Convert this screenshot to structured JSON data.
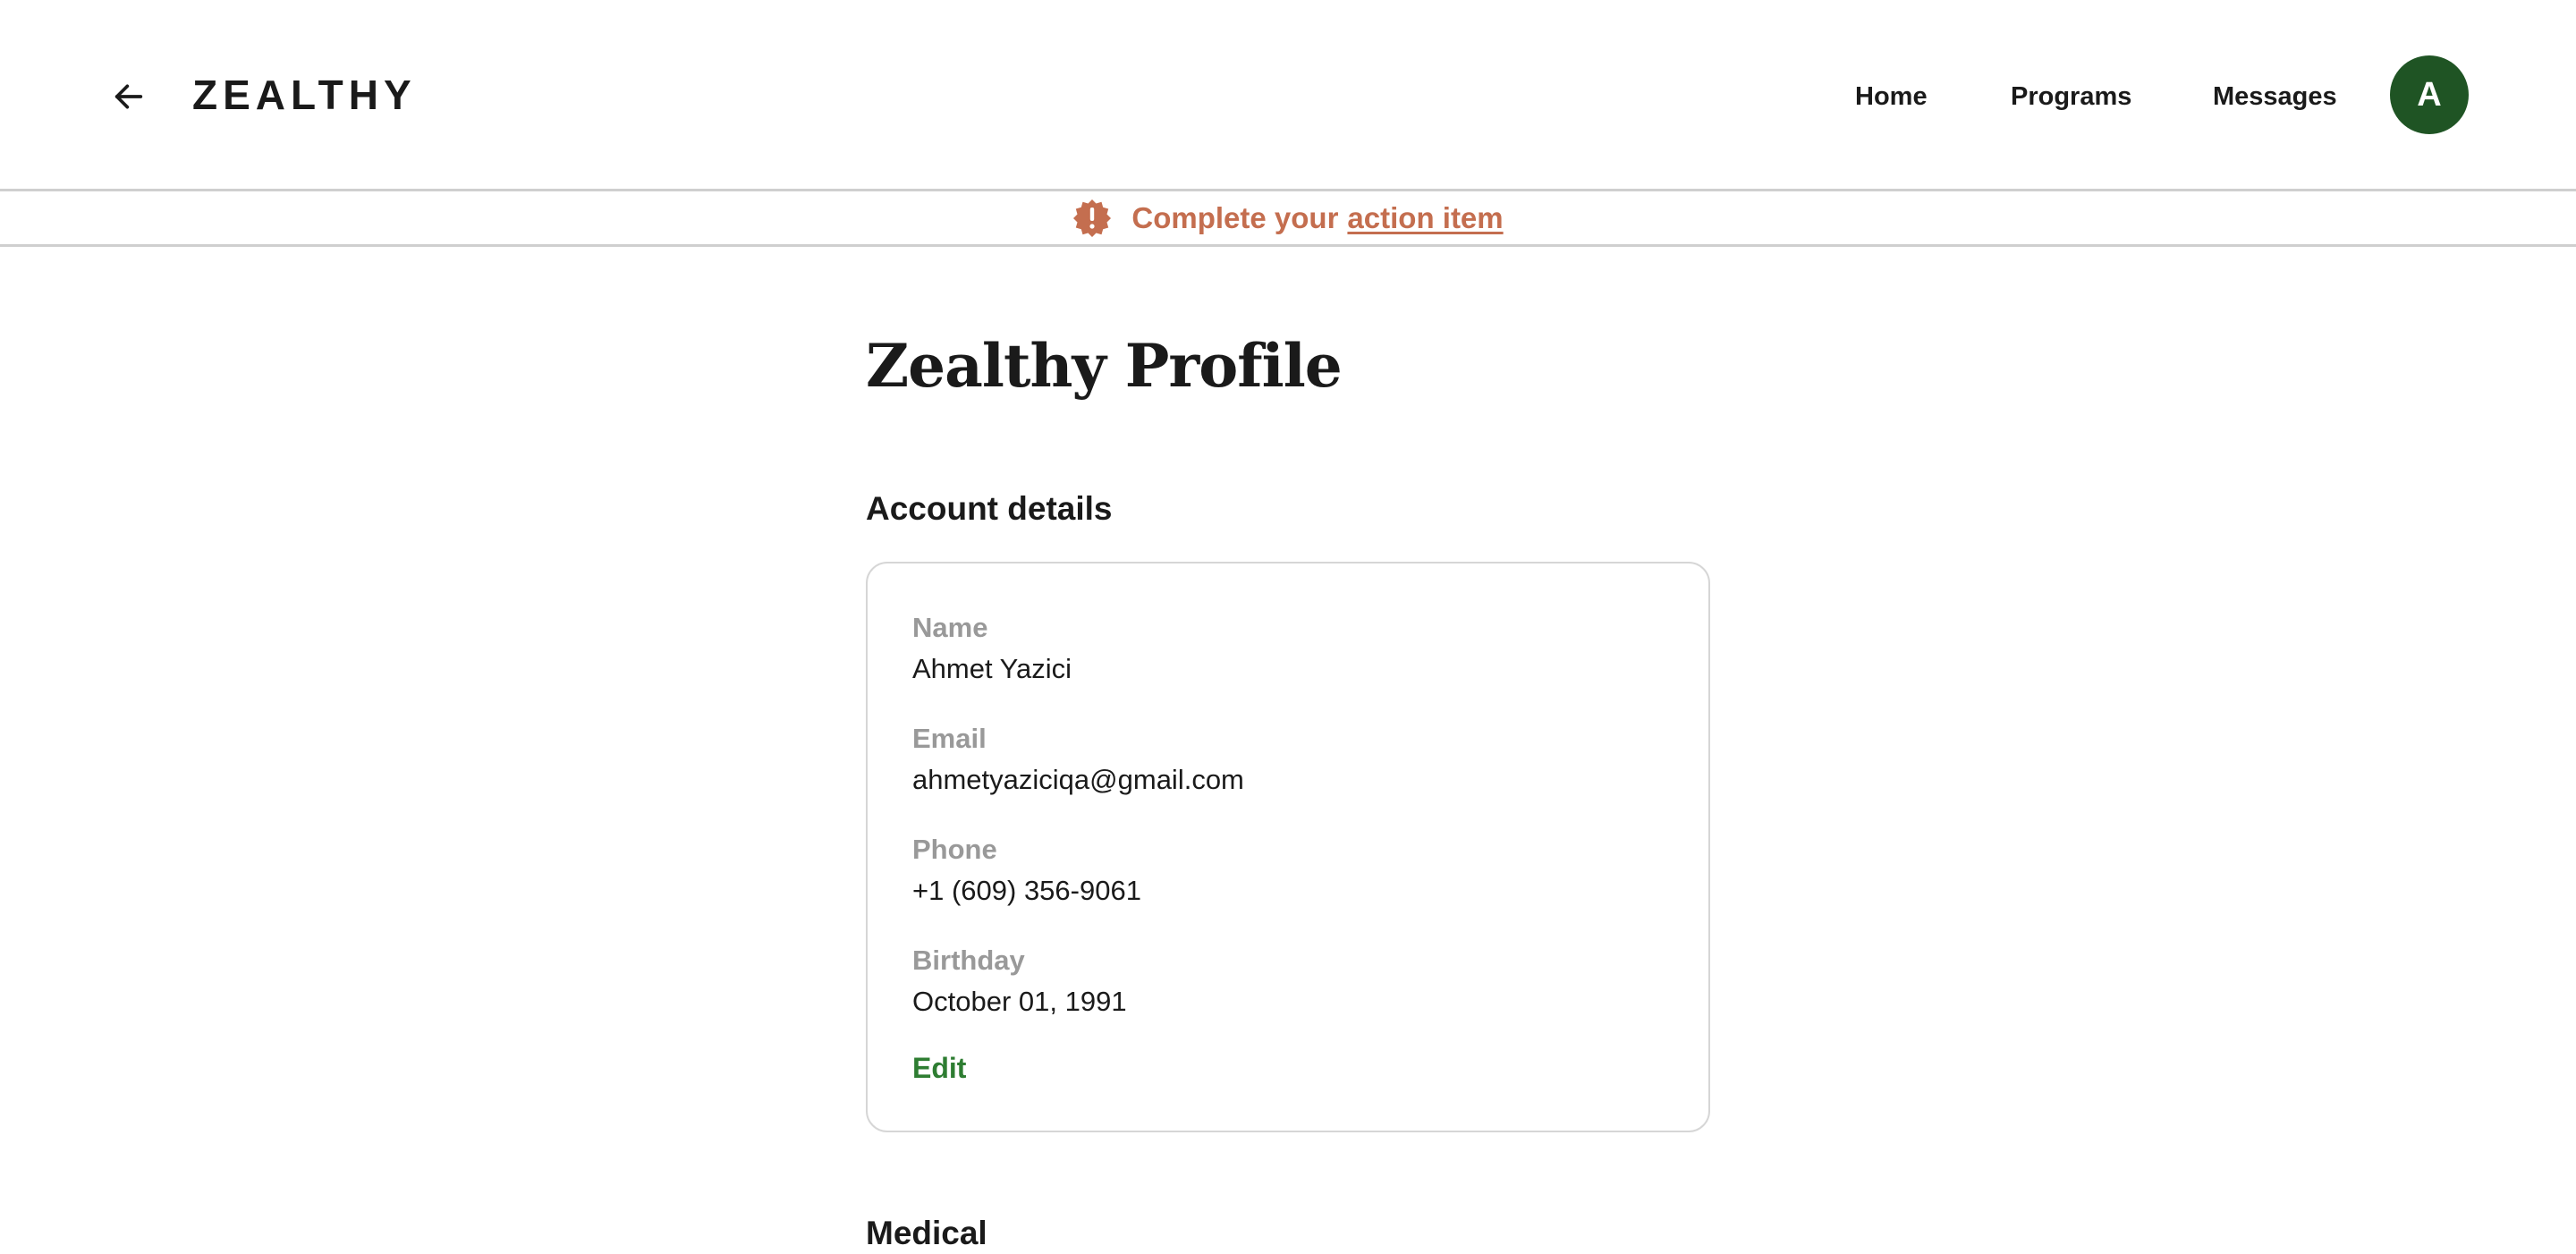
{
  "header": {
    "logo": "ZEALTHY",
    "nav": {
      "home": "Home",
      "programs": "Programs",
      "messages": "Messages"
    },
    "avatar_initial": "A",
    "avatar_color": "#1f5424",
    "back_icon": "arrow-left-icon"
  },
  "banner": {
    "icon": "alert-badge-icon",
    "text": "Complete your",
    "link": "action item",
    "color": "#c46e4f"
  },
  "main": {
    "page_title": "Zealthy Profile",
    "account_section": {
      "title": "Account details",
      "fields": [
        {
          "label": "Name",
          "value": "Ahmet Yazici"
        },
        {
          "label": "Email",
          "value": "ahmetyaziciqa@gmail.com"
        },
        {
          "label": "Phone",
          "value": "+1 (609) 356-9061"
        },
        {
          "label": "Birthday",
          "value": "October 01, 1991"
        }
      ],
      "edit_label": "Edit",
      "edit_color": "#2e7d32"
    },
    "next_section_title": "Medical  "
  }
}
